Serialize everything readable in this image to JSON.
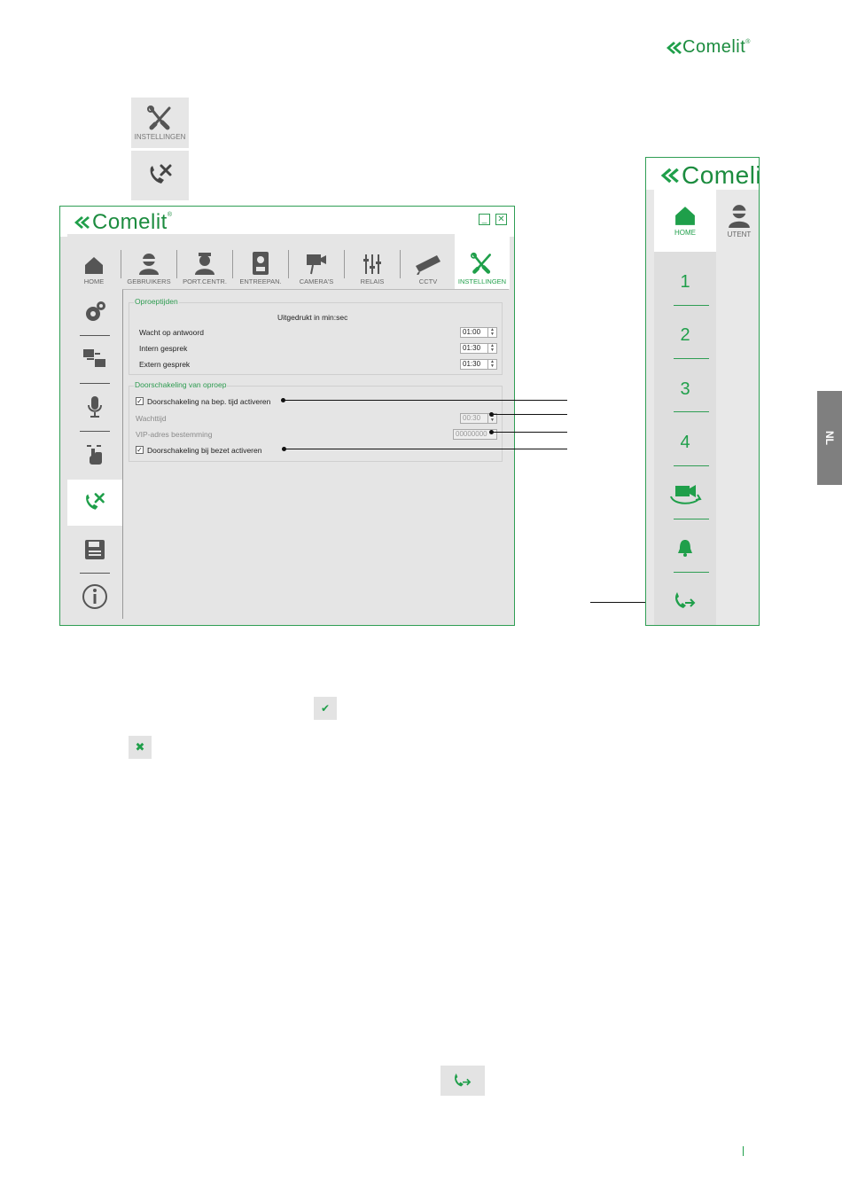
{
  "brand": {
    "name": "Comelit",
    "reg": "®",
    "color": "#1f9f4a"
  },
  "page_icons": {
    "settings_label": "INSTELLINGEN",
    "settings_icon": "tools-icon",
    "forward_icon": "call-forward-icon"
  },
  "window": {
    "minimize": "_",
    "close": "✕",
    "tabs": [
      {
        "label": "HOME",
        "icon": "home-icon"
      },
      {
        "label": "GEBRUIKERS",
        "icon": "user-icon"
      },
      {
        "label": "PORT.CENTR.",
        "icon": "porter-icon"
      },
      {
        "label": "ENTREEPAN.",
        "icon": "entrance-panel-icon"
      },
      {
        "label": "CAMERA'S",
        "icon": "camera-icon"
      },
      {
        "label": "RELAIS",
        "icon": "relay-icon"
      },
      {
        "label": "CCTV",
        "icon": "cctv-icon"
      },
      {
        "label": "INSTELLINGEN",
        "icon": "tools-icon",
        "active": true
      }
    ],
    "sidebar": [
      {
        "icon": "gear-icon"
      },
      {
        "icon": "screens-icon"
      },
      {
        "icon": "microphone-icon"
      },
      {
        "icon": "touch-icon"
      },
      {
        "icon": "call-forward-icon",
        "active": true
      },
      {
        "icon": "save-icon"
      },
      {
        "icon": "info-icon"
      }
    ],
    "call_times": {
      "title": "Oproeptijden",
      "subtitle": "Uitgedrukt in min:sec",
      "rows": [
        {
          "label": "Wacht op antwoord",
          "value": "01:00"
        },
        {
          "label": "Intern gesprek",
          "value": "01:30"
        },
        {
          "label": "Extern gesprek",
          "value": "01:30"
        }
      ]
    },
    "forwarding": {
      "title": "Doorschakeling van oproep",
      "enable_timed": {
        "label": "Doorschakeling na bep. tijd activeren",
        "checked": true
      },
      "wait_time": {
        "label": "Wachttijd",
        "value": "00:30"
      },
      "vip_address": {
        "label": "VIP-adres bestemming",
        "value": "00000000"
      },
      "enable_busy": {
        "label": "Doorschakeling bij bezet activeren",
        "checked": true
      }
    }
  },
  "phone_panel": {
    "home_label": "HOME",
    "user_label": "UTENT",
    "numbers": [
      "1",
      "2",
      "3",
      "4"
    ],
    "icons": [
      "camera-cycle-icon",
      "bell-icon",
      "call-forward-icon"
    ]
  },
  "side_tab": "NL",
  "buttons": {
    "confirm": "✔",
    "cancel": "✖"
  }
}
